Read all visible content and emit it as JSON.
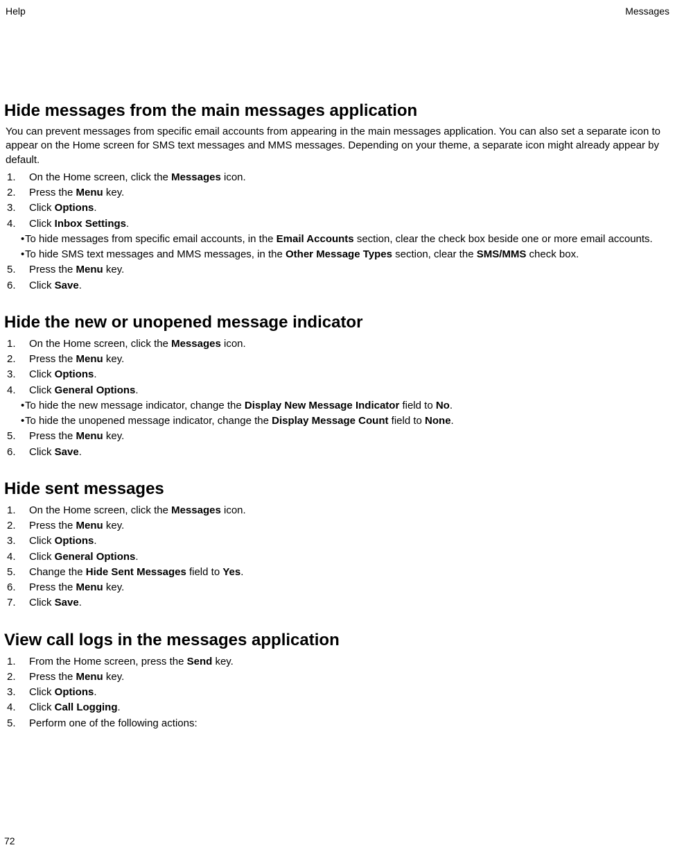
{
  "header": {
    "left": "Help",
    "right": "Messages"
  },
  "footer_page": "72",
  "sections": [
    {
      "title": "Hide messages from the main messages application",
      "intro": "You can prevent messages from specific email accounts from appearing in the main messages application. You can also set a separate icon to appear on the Home screen for SMS text messages and MMS messages. Depending on your theme, a separate icon might already appear by default.",
      "steps": [
        {
          "n": "1.",
          "pre": "On the Home screen, click the ",
          "bold": "Messages",
          "post": " icon."
        },
        {
          "n": "2.",
          "pre": "Press the ",
          "bold": "Menu",
          "post": " key."
        },
        {
          "n": "3.",
          "pre": "Click ",
          "bold": "Options",
          "post": "."
        },
        {
          "n": "4.",
          "pre": "Click ",
          "bold": "Inbox Settings",
          "post": ".",
          "sub": [
            {
              "pre": "To hide messages from specific email accounts, in the ",
              "bold": "Email Accounts",
              "post": " section, clear the check box beside one or more email accounts."
            },
            {
              "pre": "To hide SMS text messages and MMS messages, in the ",
              "bold": "Other Message Types",
              "post": " section, clear the ",
              "bold2": "SMS/MMS",
              "post2": " check box."
            }
          ]
        },
        {
          "n": "5.",
          "pre": "Press the ",
          "bold": "Menu",
          "post": " key."
        },
        {
          "n": "6.",
          "pre": "Click ",
          "bold": "Save",
          "post": "."
        }
      ]
    },
    {
      "title": "Hide the new or unopened message indicator",
      "steps": [
        {
          "n": "1.",
          "pre": "On the Home screen, click the ",
          "bold": "Messages",
          "post": " icon."
        },
        {
          "n": "2.",
          "pre": "Press the ",
          "bold": "Menu",
          "post": " key."
        },
        {
          "n": "3.",
          "pre": "Click ",
          "bold": "Options",
          "post": "."
        },
        {
          "n": "4.",
          "pre": "Click ",
          "bold": "General Options",
          "post": ".",
          "sub": [
            {
              "pre": "To hide the new message indicator, change the ",
              "bold": "Display New Message Indicator",
              "post": " field to ",
              "bold2": "No",
              "post2": "."
            },
            {
              "pre": "To hide the unopened message indicator, change the ",
              "bold": "Display Message Count",
              "post": " field to ",
              "bold2": "None",
              "post2": "."
            }
          ]
        },
        {
          "n": "5.",
          "pre": "Press the ",
          "bold": "Menu",
          "post": " key."
        },
        {
          "n": "6.",
          "pre": "Click ",
          "bold": "Save",
          "post": "."
        }
      ]
    },
    {
      "title": "Hide sent messages",
      "steps": [
        {
          "n": "1.",
          "pre": "On the Home screen, click the ",
          "bold": "Messages",
          "post": " icon."
        },
        {
          "n": "2.",
          "pre": "Press the ",
          "bold": "Menu",
          "post": " key."
        },
        {
          "n": "3.",
          "pre": "Click ",
          "bold": "Options",
          "post": "."
        },
        {
          "n": "4.",
          "pre": "Click ",
          "bold": "General Options",
          "post": "."
        },
        {
          "n": "5.",
          "pre": "Change the ",
          "bold": "Hide Sent Messages",
          "post": " field to ",
          "bold2": "Yes",
          "post2": "."
        },
        {
          "n": "6.",
          "pre": "Press the ",
          "bold": "Menu",
          "post": " key."
        },
        {
          "n": "7.",
          "pre": "Click ",
          "bold": "Save",
          "post": "."
        }
      ]
    },
    {
      "title": "View call logs in the messages application",
      "steps": [
        {
          "n": "1.",
          "pre": "From the Home screen, press the ",
          "bold": "Send",
          "post": " key."
        },
        {
          "n": "2.",
          "pre": "Press the ",
          "bold": "Menu",
          "post": " key."
        },
        {
          "n": "3.",
          "pre": "Click ",
          "bold": "Options",
          "post": "."
        },
        {
          "n": "4.",
          "pre": "Click ",
          "bold": "Call Logging",
          "post": "."
        },
        {
          "n": "5.",
          "pre": "Perform one of the following actions:",
          "bold": "",
          "post": ""
        }
      ]
    }
  ]
}
